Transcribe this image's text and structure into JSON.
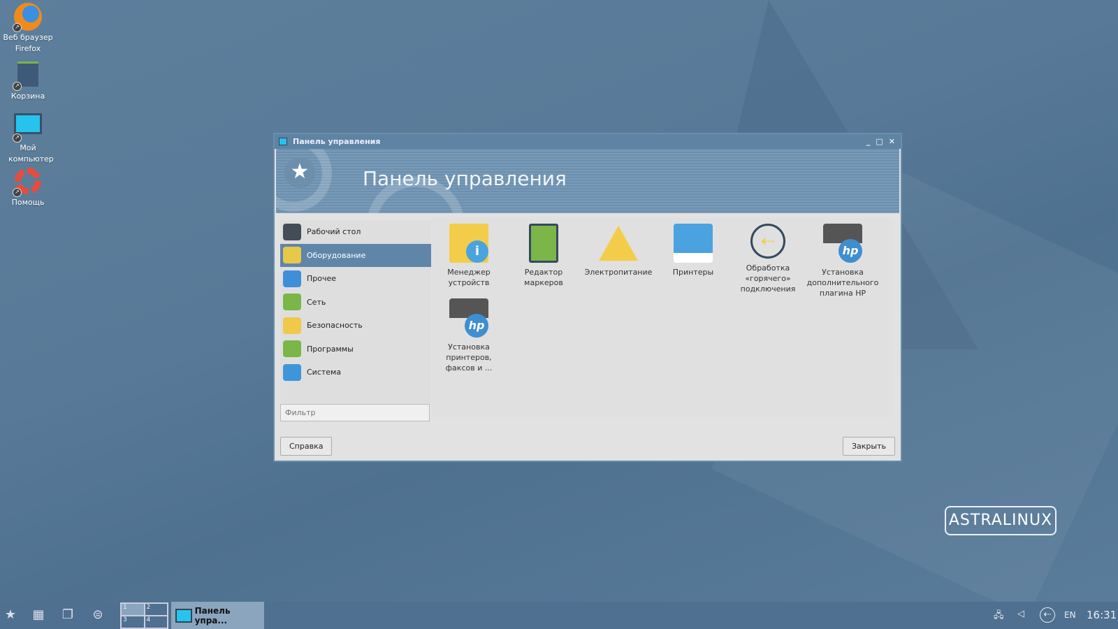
{
  "desktop": {
    "icons": [
      {
        "label": "Веб браузер Firefox",
        "icon": "firefox-icon"
      },
      {
        "label": "Корзина",
        "icon": "trash-icon"
      },
      {
        "label": "Мой компьютер",
        "icon": "computer-icon"
      },
      {
        "label": "Помощь",
        "icon": "lifebuoy-icon"
      }
    ]
  },
  "window": {
    "title": "Панель управления",
    "banner_title": "Панель управления"
  },
  "sidebar": {
    "items": [
      {
        "label": "Рабочий стол",
        "color": "#444c55"
      },
      {
        "label": "Оборудование",
        "color": "#e8c84a",
        "selected": true
      },
      {
        "label": "Прочее",
        "color": "#3f8fd8"
      },
      {
        "label": "Сеть",
        "color": "#7ab648"
      },
      {
        "label": "Безопасность",
        "color": "#f0c94a"
      },
      {
        "label": "Программы",
        "color": "#7ab648"
      },
      {
        "label": "Система",
        "color": "#3f95d9"
      }
    ]
  },
  "filter": {
    "placeholder": "Фильтр",
    "value": ""
  },
  "apps": [
    {
      "label": "Менеджер устройств",
      "icon": "device-manager-icon"
    },
    {
      "label": "Редактор маркеров",
      "icon": "marker-editor-icon"
    },
    {
      "label": "Электропитание",
      "icon": "power-icon"
    },
    {
      "label": "Принтеры",
      "icon": "printer-icon"
    },
    {
      "label": "Обработка «горячего» подключения",
      "icon": "usb-icon"
    },
    {
      "label": "Установка дополнительного плагина HP",
      "icon": "hp-printer-icon"
    },
    {
      "label": "Установка принтеров, факсов и ...",
      "icon": "hp-printer-icon"
    }
  ],
  "buttons": {
    "help": "Справка",
    "close": "Закрыть"
  },
  "taskbar": {
    "pager": [
      "1",
      "2",
      "3",
      "4"
    ],
    "task_label": "Панель упра...",
    "lang": "EN",
    "clock": "16:31"
  },
  "logo": "ASTRALINUX"
}
